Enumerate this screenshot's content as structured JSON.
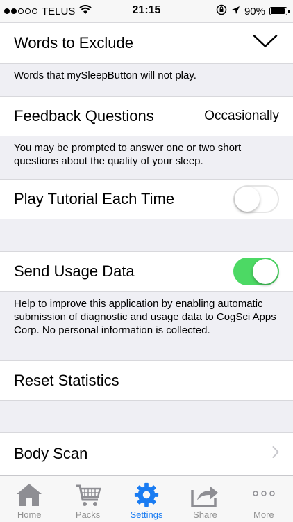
{
  "status_bar": {
    "carrier": "TELUS",
    "time": "21:15",
    "battery": "90%",
    "battery_level": 0.9,
    "signal_bars_filled": 2,
    "signal_bars_total": 5
  },
  "settings": {
    "words_to_exclude": {
      "label": "Words to Exclude",
      "note": "Words that mySleepButton will not play."
    },
    "feedback_questions": {
      "label": "Feedback Questions",
      "value": "Occasionally",
      "note": "You may be prompted to answer one or two short questions about the quality of your sleep."
    },
    "play_tutorial": {
      "label": "Play Tutorial Each Time",
      "enabled": false
    },
    "send_usage_data": {
      "label": "Send Usage Data",
      "enabled": true,
      "note": "Help to improve this application by enabling automatic submission of diagnostic and usage data to CogSci Apps Corp. No personal information is collected."
    },
    "reset_statistics": {
      "label": "Reset Statistics"
    },
    "body_scan": {
      "label": "Body Scan"
    }
  },
  "tab_bar": {
    "tabs": [
      {
        "label": "Home",
        "icon": "house-icon",
        "active": false
      },
      {
        "label": "Packs",
        "icon": "cart-icon",
        "active": false
      },
      {
        "label": "Settings",
        "icon": "gear-icon",
        "active": true
      },
      {
        "label": "Share",
        "icon": "share-icon",
        "active": false
      },
      {
        "label": "More",
        "icon": "more-icon",
        "active": false
      }
    ]
  },
  "colors": {
    "accent": "#1a7cf2",
    "toggle_on": "#4cd964",
    "inactive_tab": "#929292",
    "background": "#efeff4"
  }
}
